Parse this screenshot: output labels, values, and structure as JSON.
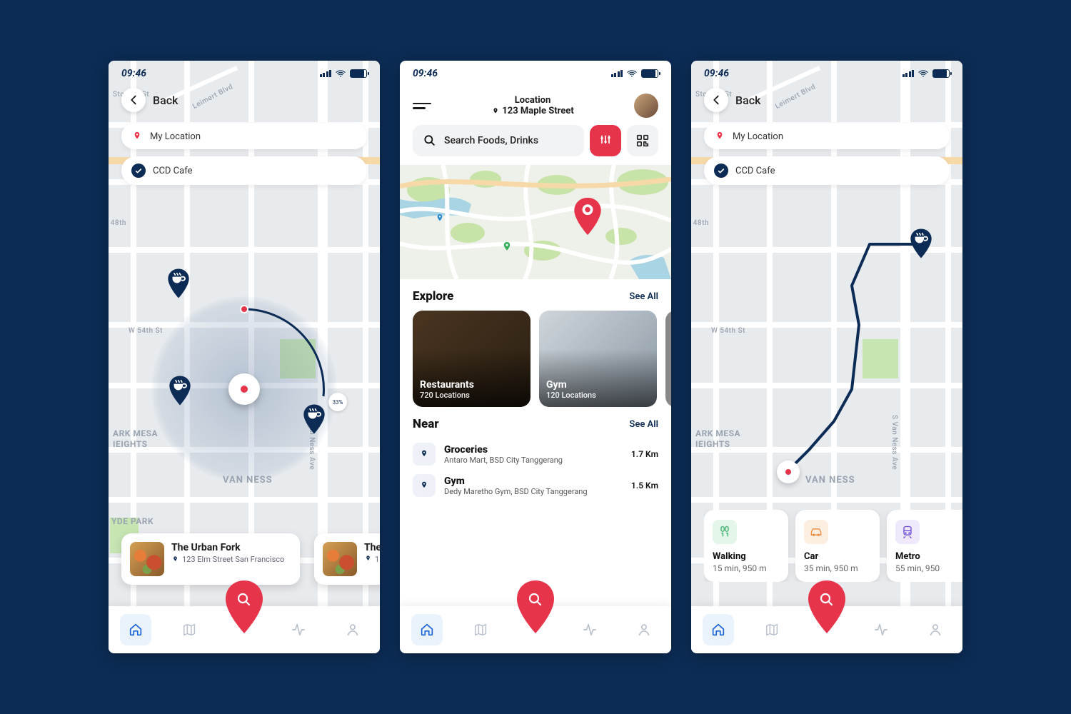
{
  "status": {
    "time": "09:46"
  },
  "back_label": "Back",
  "my_location_label": "My Location",
  "destination_label": "CCD Cafe",
  "radar_pct": "33%",
  "streets": {
    "stocker": "Stocker St",
    "leimert": "Leimert Blvd",
    "w54": "W 54th St",
    "svanness": "S Van Ness Ave",
    "vanness": "VAN NESS",
    "parkmesa1": "ARK MESA",
    "parkmesa2": "IEIGHTS",
    "hydepark": "YDE PARK",
    "fortyeighth": "48th"
  },
  "s1_results": [
    {
      "name": "The Urban Fork",
      "addr": "123 Elm Street San Francisco"
    },
    {
      "name": "The",
      "addr": "1"
    }
  ],
  "s2_header": {
    "loc_label": "Location",
    "address": "123 Maple Street"
  },
  "s2_search_placeholder": "Search Foods, Drinks",
  "s2_explore_label": "Explore",
  "s2_see_all": "See All",
  "s2_near_label": "Near",
  "s2_explore": [
    {
      "title": "Restaurants",
      "sub": "720 Locations"
    },
    {
      "title": "Gym",
      "sub": "120 Locations"
    }
  ],
  "s2_near": [
    {
      "title": "Groceries",
      "sub": "Antaro Mart, BSD City Tanggerang",
      "dist": "1.7 Km"
    },
    {
      "title": "Gym",
      "sub": "Dedy Maretho Gym, BSD City Tanggerang",
      "dist": "1.5 Km"
    }
  ],
  "s3_modes": [
    {
      "title": "Walking",
      "sub": "15 min, 950 m",
      "bg": "#e4f5e9",
      "stroke": "#39b26a"
    },
    {
      "title": "Car",
      "sub": "35 min, 950 m",
      "bg": "#fdeee2",
      "stroke": "#e88a3c"
    },
    {
      "title": "Metro",
      "sub": "55 min, 950",
      "bg": "#efe9fb",
      "stroke": "#6a4ad8"
    }
  ]
}
